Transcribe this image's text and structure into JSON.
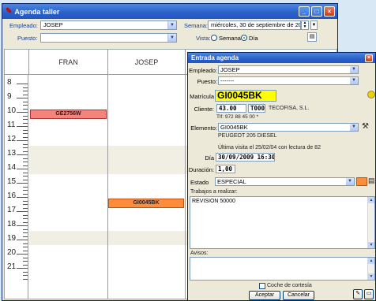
{
  "main_window": {
    "title": "Agenda taller",
    "controls": {
      "minimize": "_",
      "maximize": "□",
      "close": "×"
    }
  },
  "toolbar": {
    "empleado_label": "Empleado:",
    "empleado_value": "JOSEP",
    "puesto_label": "Puesto:",
    "puesto_value": "",
    "semana_label": "Semana:",
    "semana_value": "miércoles, 30 de septiembre de 20(",
    "vista_label": "Vista:",
    "vista_semana": "Semana",
    "vista_dia": "Día",
    "vista_selected": "Día"
  },
  "grid": {
    "columns": [
      "FRAN",
      "JOSEP",
      ""
    ],
    "hours": [
      "8",
      "9",
      "10",
      "11",
      "12",
      "13",
      "14",
      "15",
      "16",
      "17",
      "18",
      "19",
      "20",
      "21"
    ],
    "appointments": [
      {
        "label": "GE2756W",
        "column": "FRAN",
        "hour": "10",
        "color": "#f4837c"
      },
      {
        "label": "GI0045BK",
        "column": "JOSEP",
        "hour": "17",
        "color": "#ff8c3c"
      }
    ]
  },
  "dialog": {
    "title": "Entrada agenda",
    "empleado_label": "Empleado:",
    "empleado_value": "JOSEP",
    "puesto_label": "Puesto:",
    "puesto_value": "-------",
    "matricula_label": "Matrícula",
    "matricula_value": "GI0045BK",
    "cliente_label": "Cliente:",
    "cliente_num1": "43.00",
    "cliente_num2": "T000",
    "cliente_name": "TECOFISA, S.L.",
    "telefono": "Tlf: 972 88 45 00 *",
    "elemento_label": "Elemento:",
    "elemento_value": "GI0045BK",
    "vehiculo": "PEUGEOT 205 DIESEL",
    "ultima_visita": "Última visita el 25/02/04 con lectura de 82",
    "dia_label": "Día",
    "dia_value": "30/09/2009 16:30",
    "duracion_label": "Duración:",
    "duracion_value": "1,00",
    "estado_label": "Estado",
    "estado_value": "ESPECIAL",
    "estado_color": "#ff8c3c",
    "trabajos_label": "Trabajos a realizar:",
    "trabajos_value": "REVISION 50000",
    "avisos_label": "Avisos:",
    "avisos_value": "",
    "coche_cortesia_label": "Coche de cortesía",
    "aceptar_label": "Aceptar",
    "cancelar_label": "Cancelar"
  }
}
